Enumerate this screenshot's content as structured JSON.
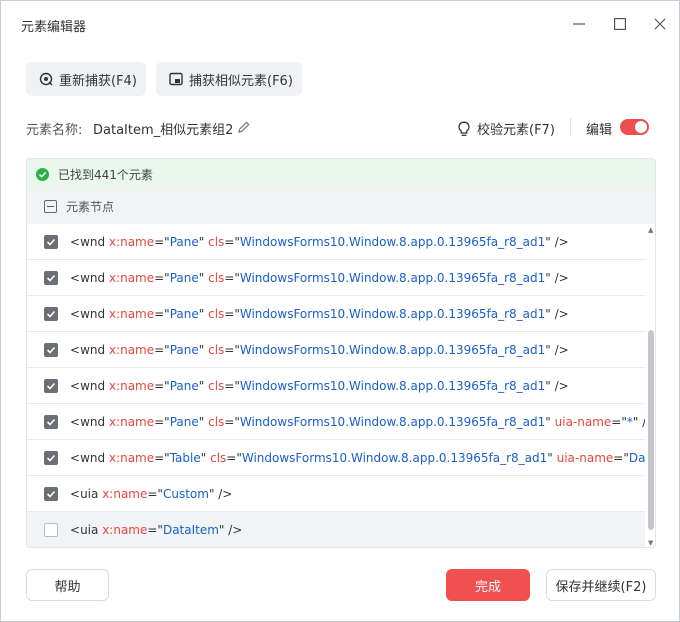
{
  "window": {
    "title": "元素编辑器"
  },
  "toolbar": {
    "recapture_label": "重新捕获(F4)",
    "capture_similar_label": "捕获相似元素(F6)"
  },
  "element_name": {
    "label": "元素名称:",
    "value": "DataItem_相似元素组2"
  },
  "verify_label": "校验元素(F7)",
  "edit": {
    "label": "编辑",
    "enabled": true
  },
  "found_text": "已找到441个元素",
  "nodes_header": "元素节点",
  "rows": [
    {
      "checked": true,
      "tag": "wnd",
      "attrs": [
        {
          "k": "x:name",
          "v": "Pane"
        },
        {
          "k": "cls",
          "v": "WindowsForms10.Window.8.app.0.13965fa_r8_ad1"
        }
      ]
    },
    {
      "checked": true,
      "tag": "wnd",
      "attrs": [
        {
          "k": "x:name",
          "v": "Pane"
        },
        {
          "k": "cls",
          "v": "WindowsForms10.Window.8.app.0.13965fa_r8_ad1"
        }
      ]
    },
    {
      "checked": true,
      "tag": "wnd",
      "attrs": [
        {
          "k": "x:name",
          "v": "Pane"
        },
        {
          "k": "cls",
          "v": "WindowsForms10.Window.8.app.0.13965fa_r8_ad1"
        }
      ]
    },
    {
      "checked": true,
      "tag": "wnd",
      "attrs": [
        {
          "k": "x:name",
          "v": "Pane"
        },
        {
          "k": "cls",
          "v": "WindowsForms10.Window.8.app.0.13965fa_r8_ad1"
        }
      ]
    },
    {
      "checked": true,
      "tag": "wnd",
      "attrs": [
        {
          "k": "x:name",
          "v": "Pane"
        },
        {
          "k": "cls",
          "v": "WindowsForms10.Window.8.app.0.13965fa_r8_ad1"
        }
      ]
    },
    {
      "checked": true,
      "tag": "wnd",
      "attrs": [
        {
          "k": "x:name",
          "v": "Pane"
        },
        {
          "k": "cls",
          "v": "WindowsForms10.Window.8.app.0.13965fa_r8_ad1"
        },
        {
          "k": "uia-name",
          "v": "*"
        }
      ]
    },
    {
      "checked": true,
      "tag": "wnd",
      "attrs": [
        {
          "k": "x:name",
          "v": "Table"
        },
        {
          "k": "cls",
          "v": "WindowsForms10.Window.8.app.0.13965fa_r8_ad1"
        },
        {
          "k": "uia-name",
          "v": "Data..."
        }
      ],
      "truncated": true
    },
    {
      "checked": true,
      "tag": "uia",
      "attrs": [
        {
          "k": "x:name",
          "v": "Custom"
        }
      ]
    },
    {
      "checked": false,
      "tag": "uia",
      "attrs": [
        {
          "k": "x:name",
          "v": "DataItem"
        }
      ]
    }
  ],
  "footer": {
    "help_label": "帮助",
    "done_label": "完成",
    "save_continue_label": "保存并继续(F2)"
  },
  "colors": {
    "accent_red": "#f0504f",
    "attr_red": "#e4473e",
    "value_blue": "#1a5fcb",
    "success_green": "#2bb14a"
  },
  "icons": [
    "minimize-icon",
    "maximize-icon",
    "close-icon",
    "recapture-icon",
    "capture-similar-icon",
    "pencil-icon",
    "bulb-icon",
    "check-circle-icon"
  ]
}
